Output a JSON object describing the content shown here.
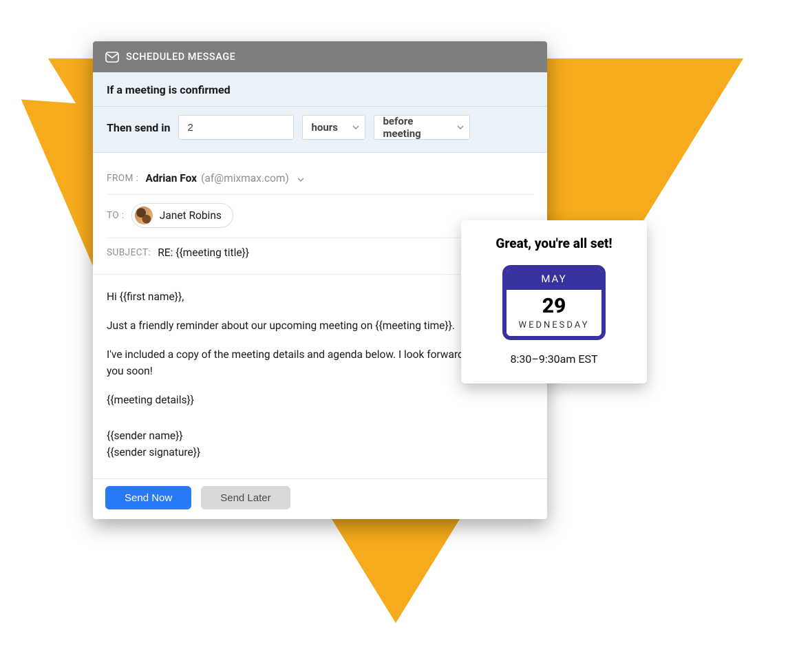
{
  "colors": {
    "accent_triangle": "#f5ab1c",
    "primary_button": "#2879f6",
    "calendar_frame": "#3832a0"
  },
  "header": {
    "title": "SCHEDULED MESSAGE"
  },
  "rule": {
    "condition": "If a meeting is confirmed",
    "then_label": "Then send in",
    "value": "2",
    "unit_selected": "hours",
    "relation_selected": "before meeting"
  },
  "from": {
    "label": "FROM :",
    "name": "Adrian Fox",
    "email": "(af@mixmax.com)"
  },
  "to": {
    "label": "TO :",
    "recipient_name": "Janet Robins"
  },
  "subject": {
    "label": "SUBJECT:",
    "value": "RE: {{meeting title}}"
  },
  "body": {
    "p1": "Hi {{first name}},",
    "p2": "Just a friendly reminder about our upcoming meeting on {{meeting time}}.",
    "p3": "I've included a copy of the meeting details and agenda below. I look forward to talking with you soon!",
    "p4": "{{meeting details}}",
    "p5a": "{{sender name}}",
    "p5b": "{{sender signature}}"
  },
  "footer": {
    "send_now": "Send Now",
    "send_later": "Send Later"
  },
  "confirm": {
    "title": "Great, you're all set!",
    "month": "MAY",
    "day": "29",
    "weekday": "WEDNESDAY",
    "time": "8:30–9:30am EST"
  }
}
